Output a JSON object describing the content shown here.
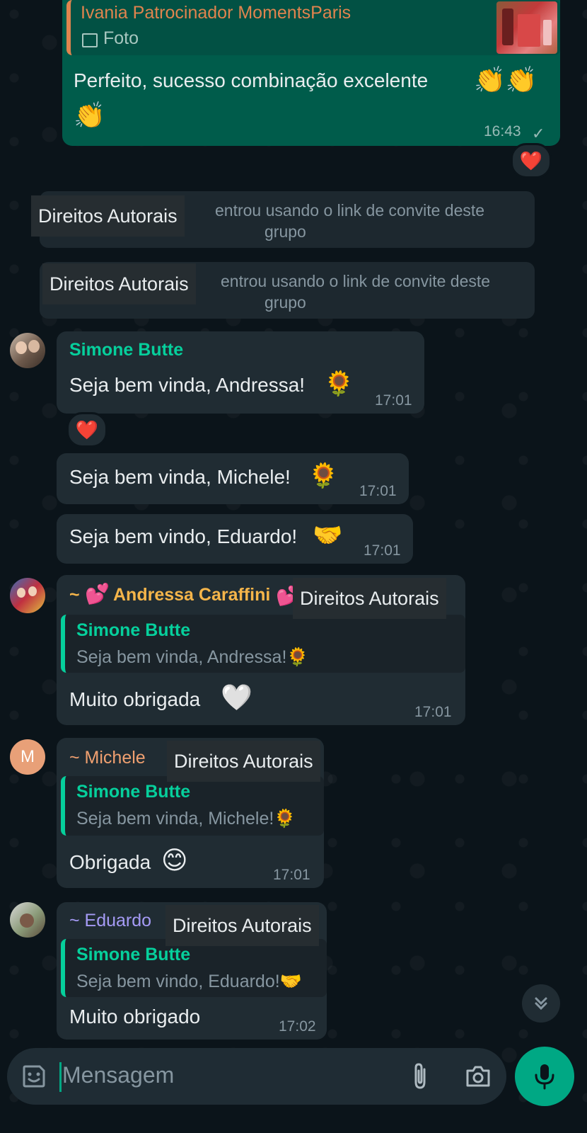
{
  "messages": {
    "top": {
      "reply_name": "Ivania Patrocinador MomentsParis",
      "reply_media": "Foto",
      "text": "Perfeito,  sucesso combinação excelente",
      "emoji_row1": "👏👏",
      "emoji_row2": "👏",
      "time": "16:43",
      "reaction": "❤️"
    },
    "system1": {
      "text": "entrou usando o link de convite deste",
      "text2": "grupo",
      "overlay": "Direitos Autorais"
    },
    "system2": {
      "text": "entrou usando o link de convite deste",
      "text2": "grupo",
      "overlay": "Direitos Autorais"
    },
    "simone": {
      "sender": "Simone Butte",
      "text": "Seja bem vinda, Andressa!",
      "emoji": "🌻",
      "time": "17:01",
      "reaction": "❤️"
    },
    "simone2": {
      "text": "Seja bem vinda, Michele!",
      "emoji": "🌻",
      "time": "17:01"
    },
    "simone3": {
      "text": "Seja bem vindo, Eduardo!",
      "emoji": "🤝",
      "time": "17:01"
    },
    "andressa": {
      "sender_prefix": "~",
      "sender": "Andressa Caraffini",
      "sender_emoji": "💕",
      "overlay": "Direitos Autorais",
      "quote_name": "Simone Butte",
      "quote_text": "Seja bem vinda, Andressa!🌻",
      "text": "Muito obrigada",
      "emoji": "🤍",
      "time": "17:01"
    },
    "michele": {
      "avatar_letter": "M",
      "sender": "~ Michele",
      "overlay": "Direitos Autorais",
      "quote_name": "Simone Butte",
      "quote_text": "Seja bem vinda, Michele!🌻",
      "text": "Obrigada",
      "emoji": "😊",
      "time": "17:01"
    },
    "eduardo": {
      "sender": "~ Eduardo",
      "overlay": "Direitos Autorais",
      "quote_name": "Simone Butte",
      "quote_text": "Seja bem vindo, Eduardo!🤝",
      "text": "Muito obrigado",
      "time": "17:02"
    }
  },
  "composer": {
    "placeholder": "Mensagem",
    "emoji_icon": "emoji-icon",
    "attach_icon": "paperclip-icon",
    "camera_icon": "camera-icon",
    "mic_icon": "mic-icon"
  },
  "colors": {
    "background": "#0b141a",
    "incoming": "#202c33",
    "outgoing": "#005c4b",
    "accent": "#00a884",
    "andressa_name": "#f5b54a",
    "michele_name": "#f0a070",
    "eduardo_name": "#a59bf5"
  }
}
